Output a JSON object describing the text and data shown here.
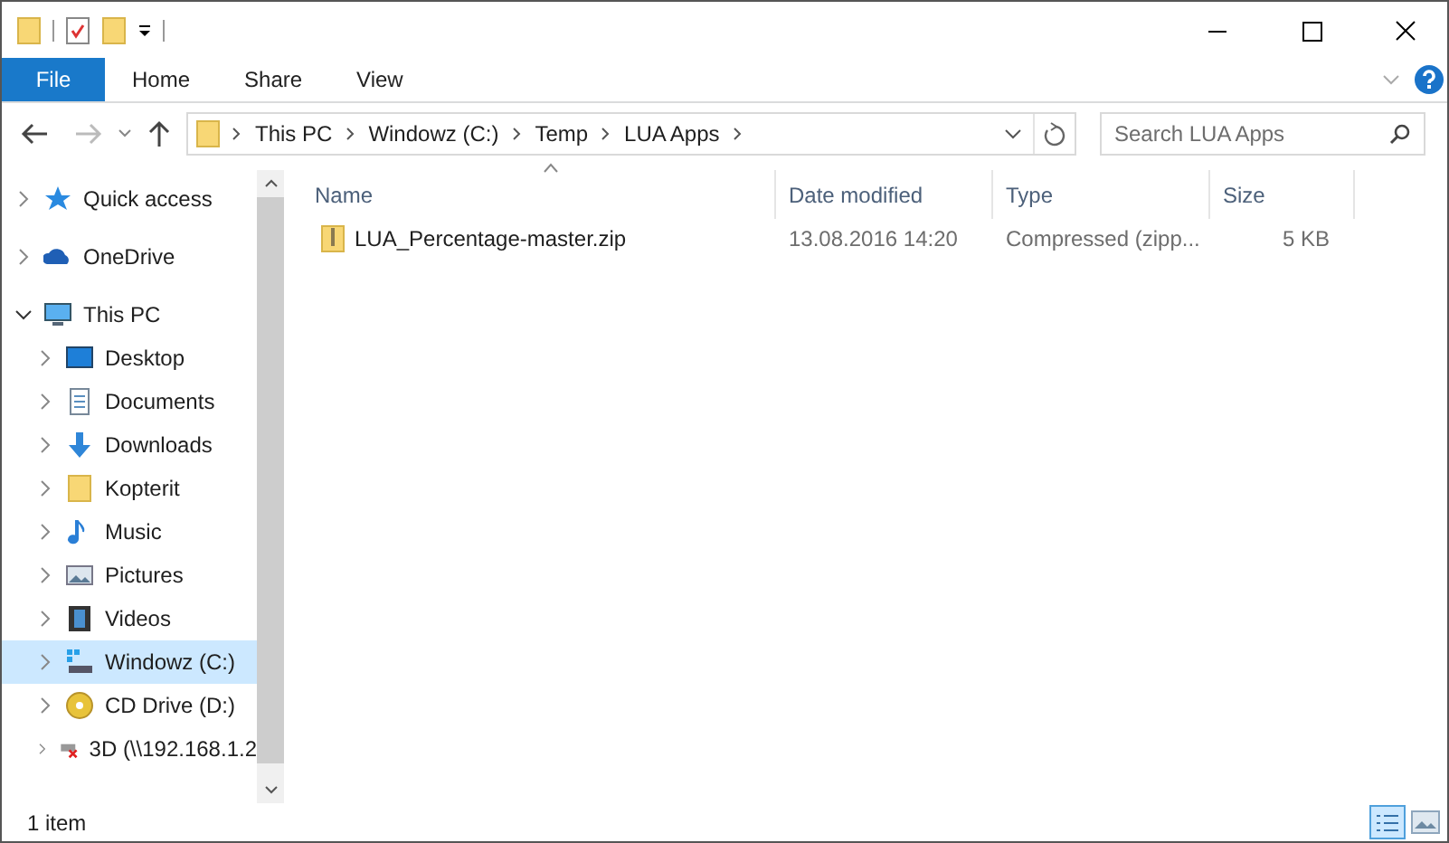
{
  "ribbon_tabs": [
    {
      "label": "File",
      "selected": true
    },
    {
      "label": "Home",
      "selected": false
    },
    {
      "label": "Share",
      "selected": false
    },
    {
      "label": "View",
      "selected": false
    }
  ],
  "address_bar": {
    "crumbs": [
      "This PC",
      "Windowz (C:)",
      "Temp",
      "LUA Apps"
    ]
  },
  "search": {
    "placeholder": "Search LUA Apps"
  },
  "sidebar": {
    "items": [
      {
        "label": "Quick access",
        "expanded": false,
        "selected": false
      },
      {
        "label": "OneDrive",
        "expanded": false,
        "selected": false
      },
      {
        "label": "This PC",
        "expanded": true,
        "selected": false,
        "children": [
          {
            "label": "Desktop",
            "expanded": false,
            "selected": false
          },
          {
            "label": "Documents",
            "expanded": false,
            "selected": false
          },
          {
            "label": "Downloads",
            "expanded": false,
            "selected": false
          },
          {
            "label": "Kopterit",
            "expanded": false,
            "selected": false
          },
          {
            "label": "Music",
            "expanded": false,
            "selected": false
          },
          {
            "label": "Pictures",
            "expanded": false,
            "selected": false
          },
          {
            "label": "Videos",
            "expanded": false,
            "selected": false
          },
          {
            "label": "Windowz (C:)",
            "expanded": false,
            "selected": true
          },
          {
            "label": "CD Drive (D:)",
            "expanded": false,
            "selected": false
          },
          {
            "label": "3D (\\\\192.168.1.2",
            "expanded": false,
            "selected": false
          }
        ]
      }
    ]
  },
  "table": {
    "columns": [
      "Name",
      "Date modified",
      "Type",
      "Size"
    ],
    "rows": [
      {
        "name": "LUA_Percentage-master.zip",
        "date_modified": "13.08.2016 14:20",
        "type": "Compressed (zipp...",
        "size": "5 KB"
      }
    ]
  },
  "status_bar": {
    "text": "1 item"
  }
}
